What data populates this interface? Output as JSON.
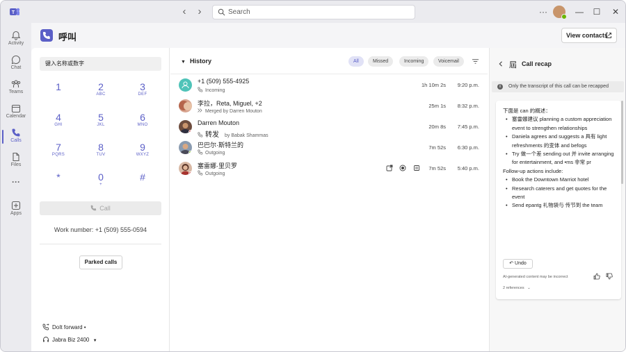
{
  "titlebar": {
    "search_placeholder": "Search",
    "more_label": "···",
    "minimize": "—",
    "maximize": "☐",
    "close": "✕",
    "back_glyph": "‹",
    "forward_glyph": "›"
  },
  "rail": {
    "items": [
      {
        "label": "Activity",
        "icon": "bell-icon"
      },
      {
        "label": "Chat",
        "icon": "chat-icon"
      },
      {
        "label": "Teams",
        "icon": "teams-icon"
      },
      {
        "label": "Calendar",
        "icon": "calendar-icon"
      },
      {
        "label": "Calls",
        "icon": "phone-icon"
      },
      {
        "label": "Files",
        "icon": "file-icon"
      },
      {
        "label": "···",
        "icon": "more-icon"
      },
      {
        "label": "Apps",
        "icon": "apps-icon"
      }
    ]
  },
  "header": {
    "title": "呼叫",
    "view_contacts": "View contacts"
  },
  "dialpad": {
    "input_text": "键入名称或数字",
    "keys": [
      {
        "num": "1",
        "letters": ""
      },
      {
        "num": "2",
        "letters": "ABC"
      },
      {
        "num": "3",
        "letters": "DEF"
      },
      {
        "num": "4",
        "letters": "GHI"
      },
      {
        "num": "5",
        "letters": "JKL"
      },
      {
        "num": "6",
        "letters": "MNO"
      },
      {
        "num": "7",
        "letters": "PQRS"
      },
      {
        "num": "8",
        "letters": "TUV"
      },
      {
        "num": "9",
        "letters": "WXYZ"
      },
      {
        "num": "*",
        "letters": ""
      },
      {
        "num": "0",
        "letters": "+"
      },
      {
        "num": "#",
        "letters": ""
      }
    ],
    "call_label": "Call",
    "work_number": "Work number: +1 (509) 555-0594",
    "parked_calls": "Parked calls",
    "forward_label": "DoIt forward •",
    "device_label": "Jabra Biz 2400"
  },
  "history": {
    "title": "History",
    "filters": [
      "All",
      "Missed",
      "Incoming",
      "Voicemail"
    ],
    "rows": [
      {
        "name": "+1 (509) 555-4925",
        "sub": "Incoming",
        "duration": "1h 10m 2s",
        "time": "9:20 p.m."
      },
      {
        "name": "李拉，Reta, Miguel, +2",
        "sub": "Merged by Darren Mouton",
        "duration": "25m 1s",
        "time": "8:32 p.m."
      },
      {
        "name": "Darren Mouton",
        "sub_prefix": "转发",
        "sub": "by Babak Shammas",
        "duration": "20m 8s",
        "time": "7:45 p.m."
      },
      {
        "name": "巴巴尔·斯特兰的",
        "sub": "Outgoing",
        "duration": "7m 52s",
        "time": "6:30 p.m."
      },
      {
        "name": "塞雷娜·里贝罗",
        "sub": "Outgoing",
        "duration": "7m 52s",
        "time": "5:40 p.m."
      }
    ]
  },
  "recap": {
    "glyph": "屆",
    "title": "Call recap",
    "notice": "Only the transcript of this call can be recapped",
    "intro": "下面是 can 的概述：",
    "bullets_1": [
      "塞雷娜建议 planning a custom appreciation event to strengthen relationships",
      "Daniela agrees and suggests a 具有 light refreshments 的变体 and befogs",
      "Try 做一个差 sending out 并 invite arranging for entertainment, and •ms 非常 pr"
    ],
    "followup_heading": "Follow-up actions include:",
    "bullets_2": [
      "Book the Downtown Marriot hotel",
      "Research caterers and get quotes for the event",
      "Send epantg 礼物袋与 传节到 the team"
    ],
    "undo": "Undo",
    "ai_note": "AI-generated content may be incorrect",
    "references": "2 references"
  },
  "colors": {
    "accent": "#5b5fc7",
    "presence_available": "#6bb700",
    "presence_busy": "#d13438",
    "teal_avatar": "#4fc3b8"
  }
}
